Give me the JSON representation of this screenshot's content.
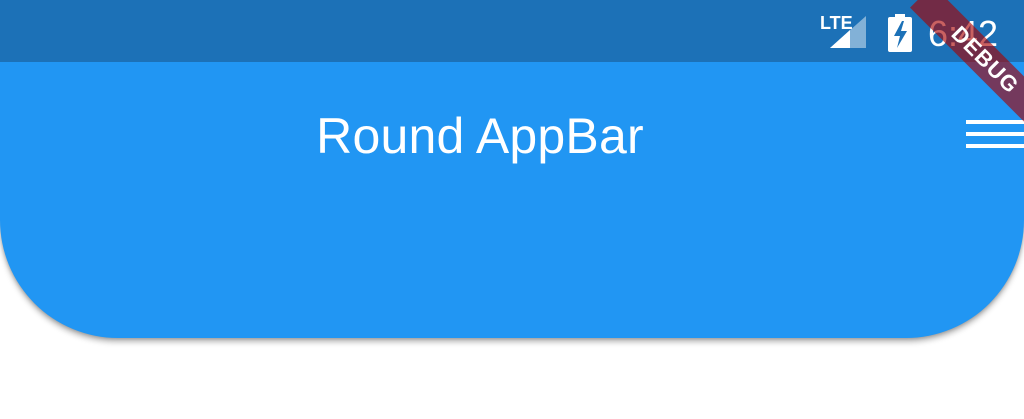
{
  "status_bar": {
    "network_label": "LTE",
    "time": "6:42",
    "signal_icon": "cellular-signal-icon",
    "battery_icon": "battery-charging-icon",
    "color": "#1c71b7"
  },
  "app_bar": {
    "title": "Round AppBar",
    "menu_icon": "hamburger-menu-icon",
    "color": "#2196f3"
  },
  "debug_banner": {
    "label": "DEBUG",
    "color": "#a80000"
  }
}
